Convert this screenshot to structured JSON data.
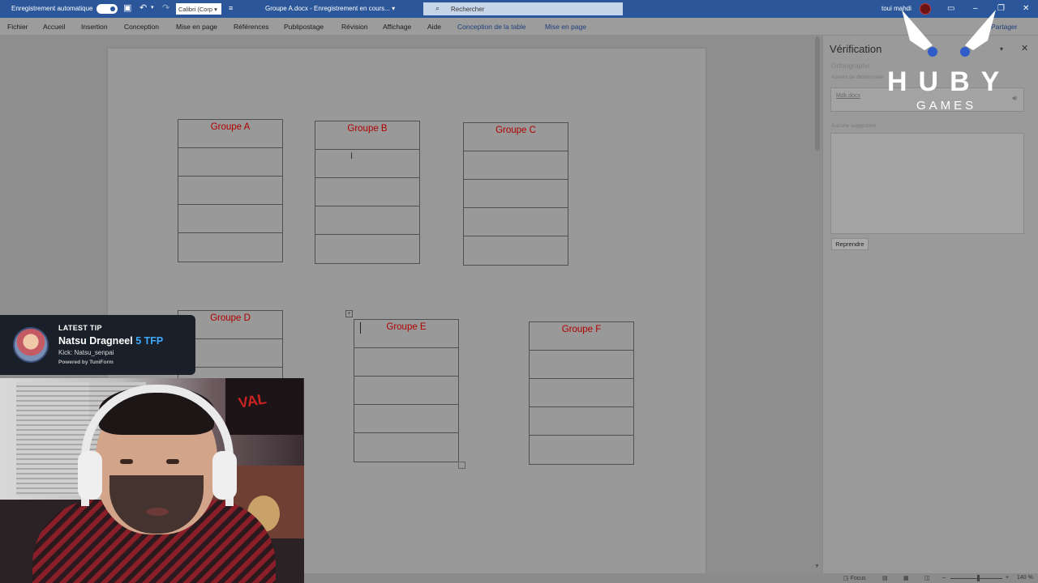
{
  "titlebar": {
    "autosave_label": "Enregistrement automatique",
    "font_name": "Calibri (Corp",
    "doc_title": "Groupe A.docx  -  Enregistrement en cours...",
    "search_placeholder": "Rechercher",
    "user_name": "toui mahdi"
  },
  "ribbon": {
    "tabs": [
      "Fichier",
      "Accueil",
      "Insertion",
      "Conception",
      "Mise en page",
      "Références",
      "Publipostage",
      "Révision",
      "Affichage",
      "Aide",
      "Conception de la table",
      "Mise en page"
    ],
    "share_label": "Partager"
  },
  "document": {
    "tables": [
      {
        "title": "Groupe A"
      },
      {
        "title": "Groupe B"
      },
      {
        "title": "Groupe C"
      },
      {
        "title": "Groupe D"
      },
      {
        "title": "Groupe E"
      },
      {
        "title": "Groupe F"
      }
    ],
    "title_color": "#b00000"
  },
  "pane": {
    "title": "Vérification",
    "section": "Orthographe",
    "hint": "Absent du dictionnaire",
    "word": "Mdk.docx",
    "no_suggestions": "Aucune suggestion",
    "resume_button": "Reprendre"
  },
  "statusbar": {
    "focus": "Focus",
    "zoom": "140 %"
  },
  "tip": {
    "header": "LATEST TIP",
    "name": "Natsu Dragneel",
    "amount": "5 TFP",
    "kick": "Kick: Natsu_senpai",
    "powered": "Powered by TuniForm"
  },
  "logo": {
    "letters": "HUBY",
    "sub": "GAMES"
  },
  "colors": {
    "titlebar": "#2b579a",
    "amount": "#3fa8ff"
  }
}
